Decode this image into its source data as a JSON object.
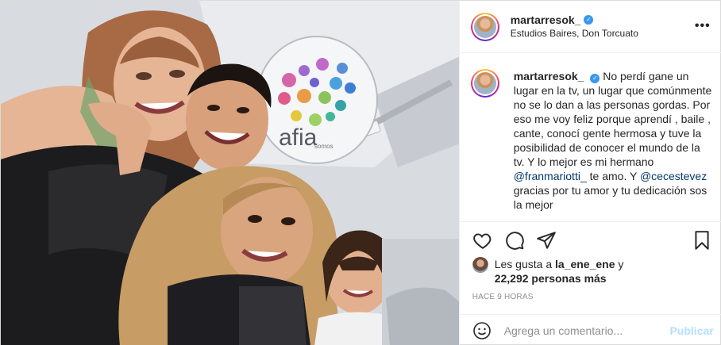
{
  "post": {
    "header": {
      "username": "martarresok_",
      "location": "Estudios Baires, Don Torcuato",
      "more_icon": "more-horizontal-icon"
    },
    "caption": {
      "username": "martarresok_",
      "text_1": "No perdí gane un lugar en la tv, un lugar que comúnmente no se lo dan a las personas gordas. Por eso me voy feliz porque aprendí , baile , cante, conocí gente hermosa y tuve la posibilidad de conocer el mundo de la tv. Y lo mejor es mi hermano ",
      "mention_1": "@franmariotti_",
      "text_2": " te amo. Y ",
      "mention_2": "@cecestevez",
      "text_3": " gracias por tu amor y tu dedicación sos la mejor"
    },
    "actions": {
      "like_icon": "heart-icon",
      "comment_icon": "comment-icon",
      "share_icon": "paper-plane-icon",
      "save_icon": "bookmark-icon"
    },
    "likes": {
      "prefix": "Les gusta a ",
      "user": "la_ene_ene",
      "middle": " y",
      "count": "22,292 personas más"
    },
    "time": "HACE 9 HORAS",
    "comment": {
      "placeholder": "Agrega un comentario...",
      "publish_label": "Publicar",
      "emoji_icon": "emoji-icon"
    },
    "photo": {
      "logo_text": "afia",
      "logo_subtext": "somos"
    },
    "colors": {
      "link": "#00376b",
      "verified": "#3897f0",
      "publish_disabled": "#b2dffc",
      "muted": "#8e8e8e"
    }
  }
}
